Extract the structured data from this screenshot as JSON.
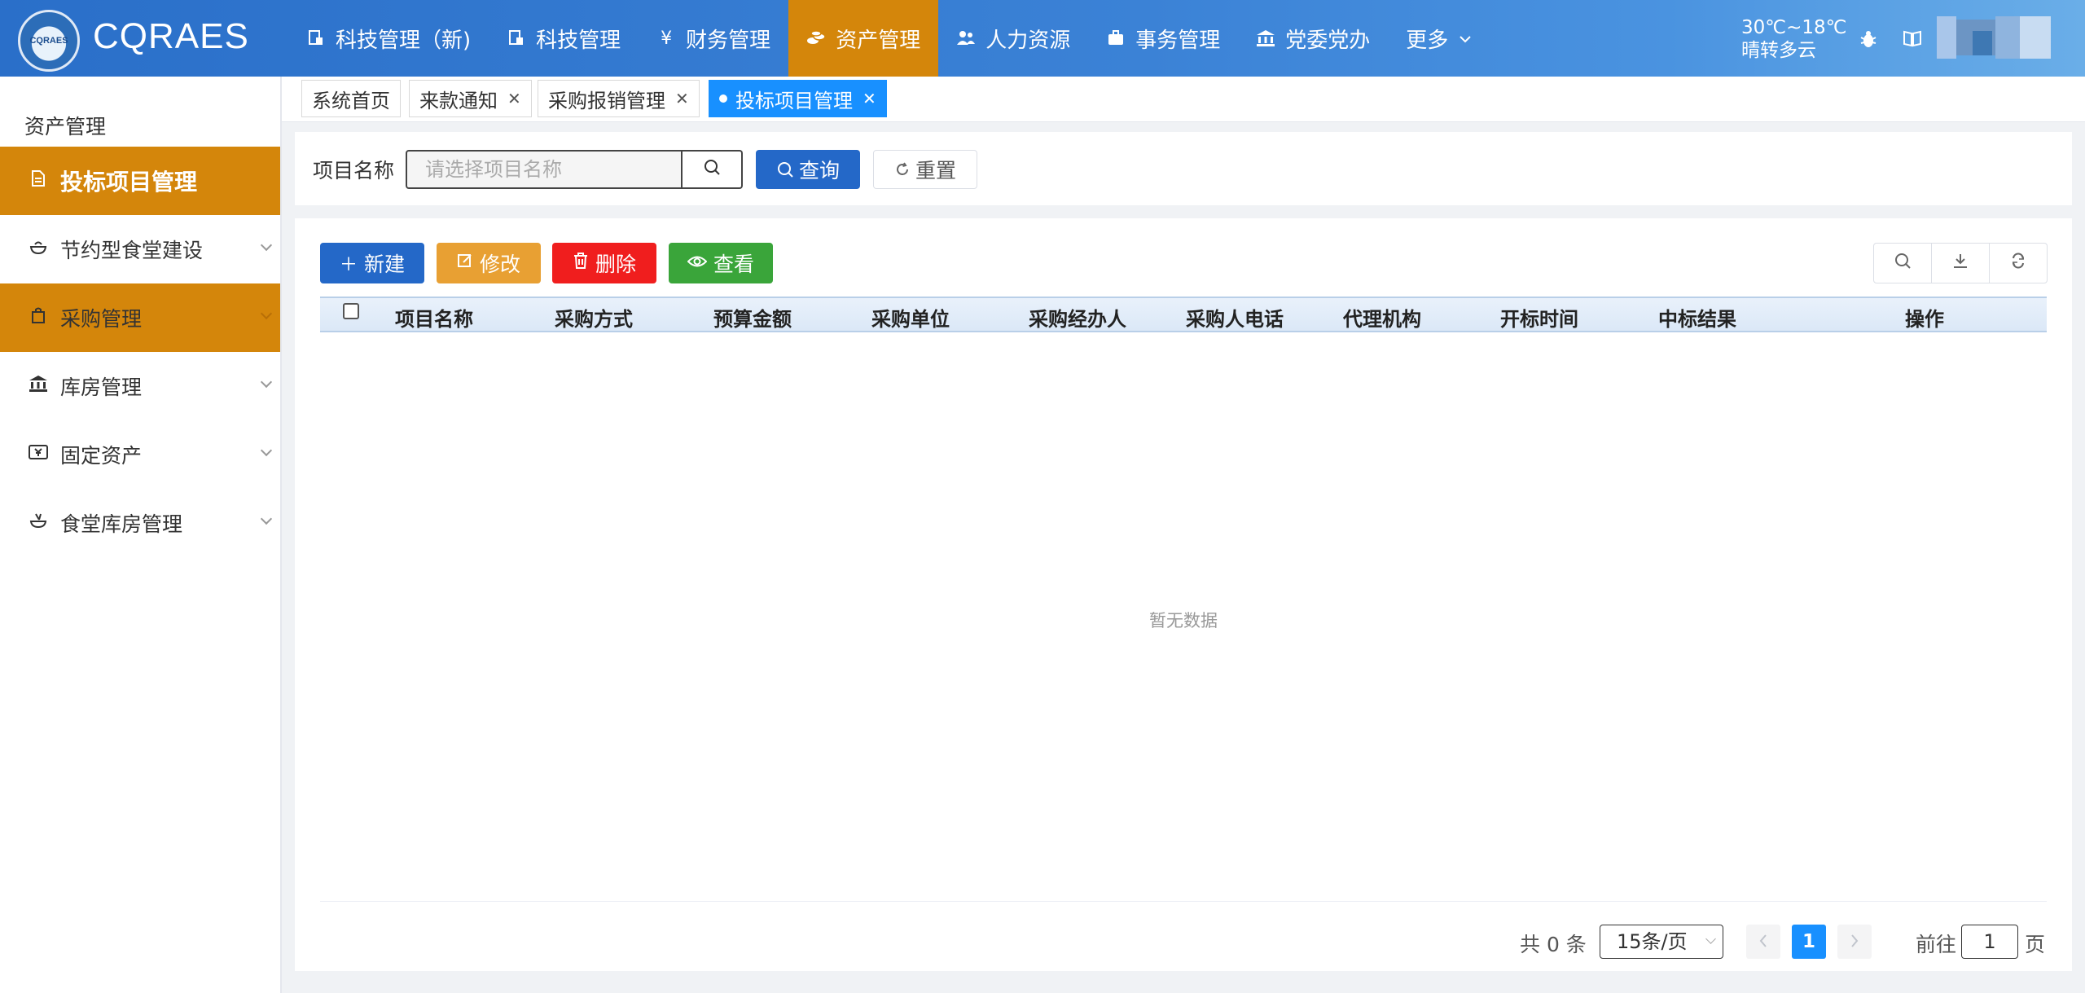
{
  "header": {
    "brand": "CQRAES",
    "logo_text": "CQRAES",
    "nav": [
      {
        "label": "科技管理（新)",
        "icon": "document-icon"
      },
      {
        "label": "科技管理",
        "icon": "document-icon"
      },
      {
        "label": "财务管理",
        "icon": "yen-icon"
      },
      {
        "label": "资产管理",
        "icon": "coins-icon"
      },
      {
        "label": "人力资源",
        "icon": "users-icon"
      },
      {
        "label": "事务管理",
        "icon": "briefcase-icon"
      },
      {
        "label": "党委党办",
        "icon": "bank-icon"
      },
      {
        "label": "更多",
        "icon": "chevron-down-icon"
      }
    ],
    "weather_temp": "30℃~18℃",
    "weather_desc": "晴转多云"
  },
  "sidebar": {
    "title": "资产管理",
    "items": [
      {
        "label": "投标项目管理",
        "icon": "document-icon"
      },
      {
        "label": "节约型食堂建设",
        "icon": "bowl-icon"
      },
      {
        "label": "采购管理",
        "icon": "bag-icon"
      },
      {
        "label": "库房管理",
        "icon": "bank-icon"
      },
      {
        "label": "固定资产",
        "icon": "ticket-icon"
      },
      {
        "label": "食堂库房管理",
        "icon": "food-icon"
      }
    ]
  },
  "tabs": [
    {
      "label": "系统首页"
    },
    {
      "label": "来款通知"
    },
    {
      "label": "采购报销管理"
    },
    {
      "label": "投标项目管理"
    }
  ],
  "search": {
    "label": "项目名称",
    "placeholder": "请选择项目名称",
    "query_label": "查询",
    "reset_label": "重置"
  },
  "toolbar": {
    "new_label": "新建",
    "edit_label": "修改",
    "delete_label": "删除",
    "view_label": "查看"
  },
  "table": {
    "columns": [
      "项目名称",
      "采购方式",
      "预算金额",
      "采购单位",
      "采购经办人",
      "采购人电话",
      "代理机构",
      "开标时间",
      "中标结果",
      "操作"
    ],
    "rows": [],
    "empty_text": "暂无数据"
  },
  "pagination": {
    "total_text": "共 0 条",
    "page_size": "15条/页",
    "current_page": "1",
    "goto_label": "前往",
    "goto_value": "1",
    "page_suffix": "页"
  },
  "colors": {
    "header_blue": "#2a6fc9",
    "active_orange": "#d4860b",
    "primary": "#2468c8",
    "tab_active": "#1890ff",
    "edit": "#e8a033",
    "delete": "#f01e1e",
    "view": "#3aa53a"
  }
}
